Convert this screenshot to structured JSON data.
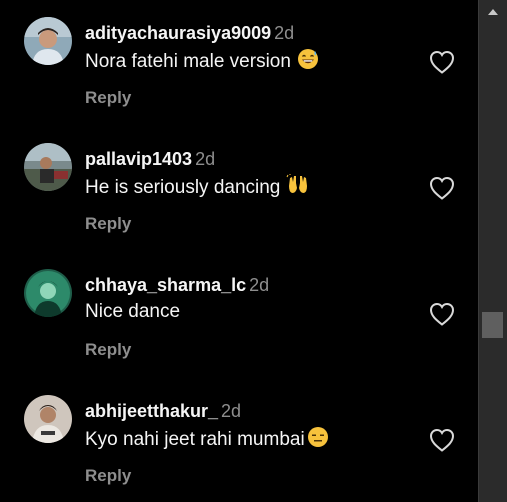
{
  "comments": [
    {
      "username": "adityachaurasiya9009",
      "time": "2d",
      "text": "Nora fatehi male version",
      "emoji": "grinning-sweat-emoji",
      "reply_label": "Reply"
    },
    {
      "username": "pallavip1403",
      "time": "2d",
      "text": "He is seriously dancing",
      "emoji": "raising-hands-emoji",
      "reply_label": "Reply"
    },
    {
      "username": "chhaya_sharma_lc",
      "time": "2d",
      "text": "Nice dance",
      "emoji": "",
      "reply_label": "Reply"
    },
    {
      "username": "abhijeetthakur_",
      "time": "2d",
      "text": "Kyo nahi jeet rahi mumbai",
      "emoji": "expressionless-face-emoji",
      "reply_label": "Reply"
    }
  ],
  "icons": {
    "like": "heart-outline-icon",
    "scroll_up": "scroll-up-arrow-icon"
  },
  "colors": {
    "background": "#000000",
    "primary_text": "#f5f5f5",
    "secondary_text": "#8e8e8e",
    "scrollbar_track": "#2b2b2b",
    "scrollbar_thumb": "#5f5f5f"
  }
}
